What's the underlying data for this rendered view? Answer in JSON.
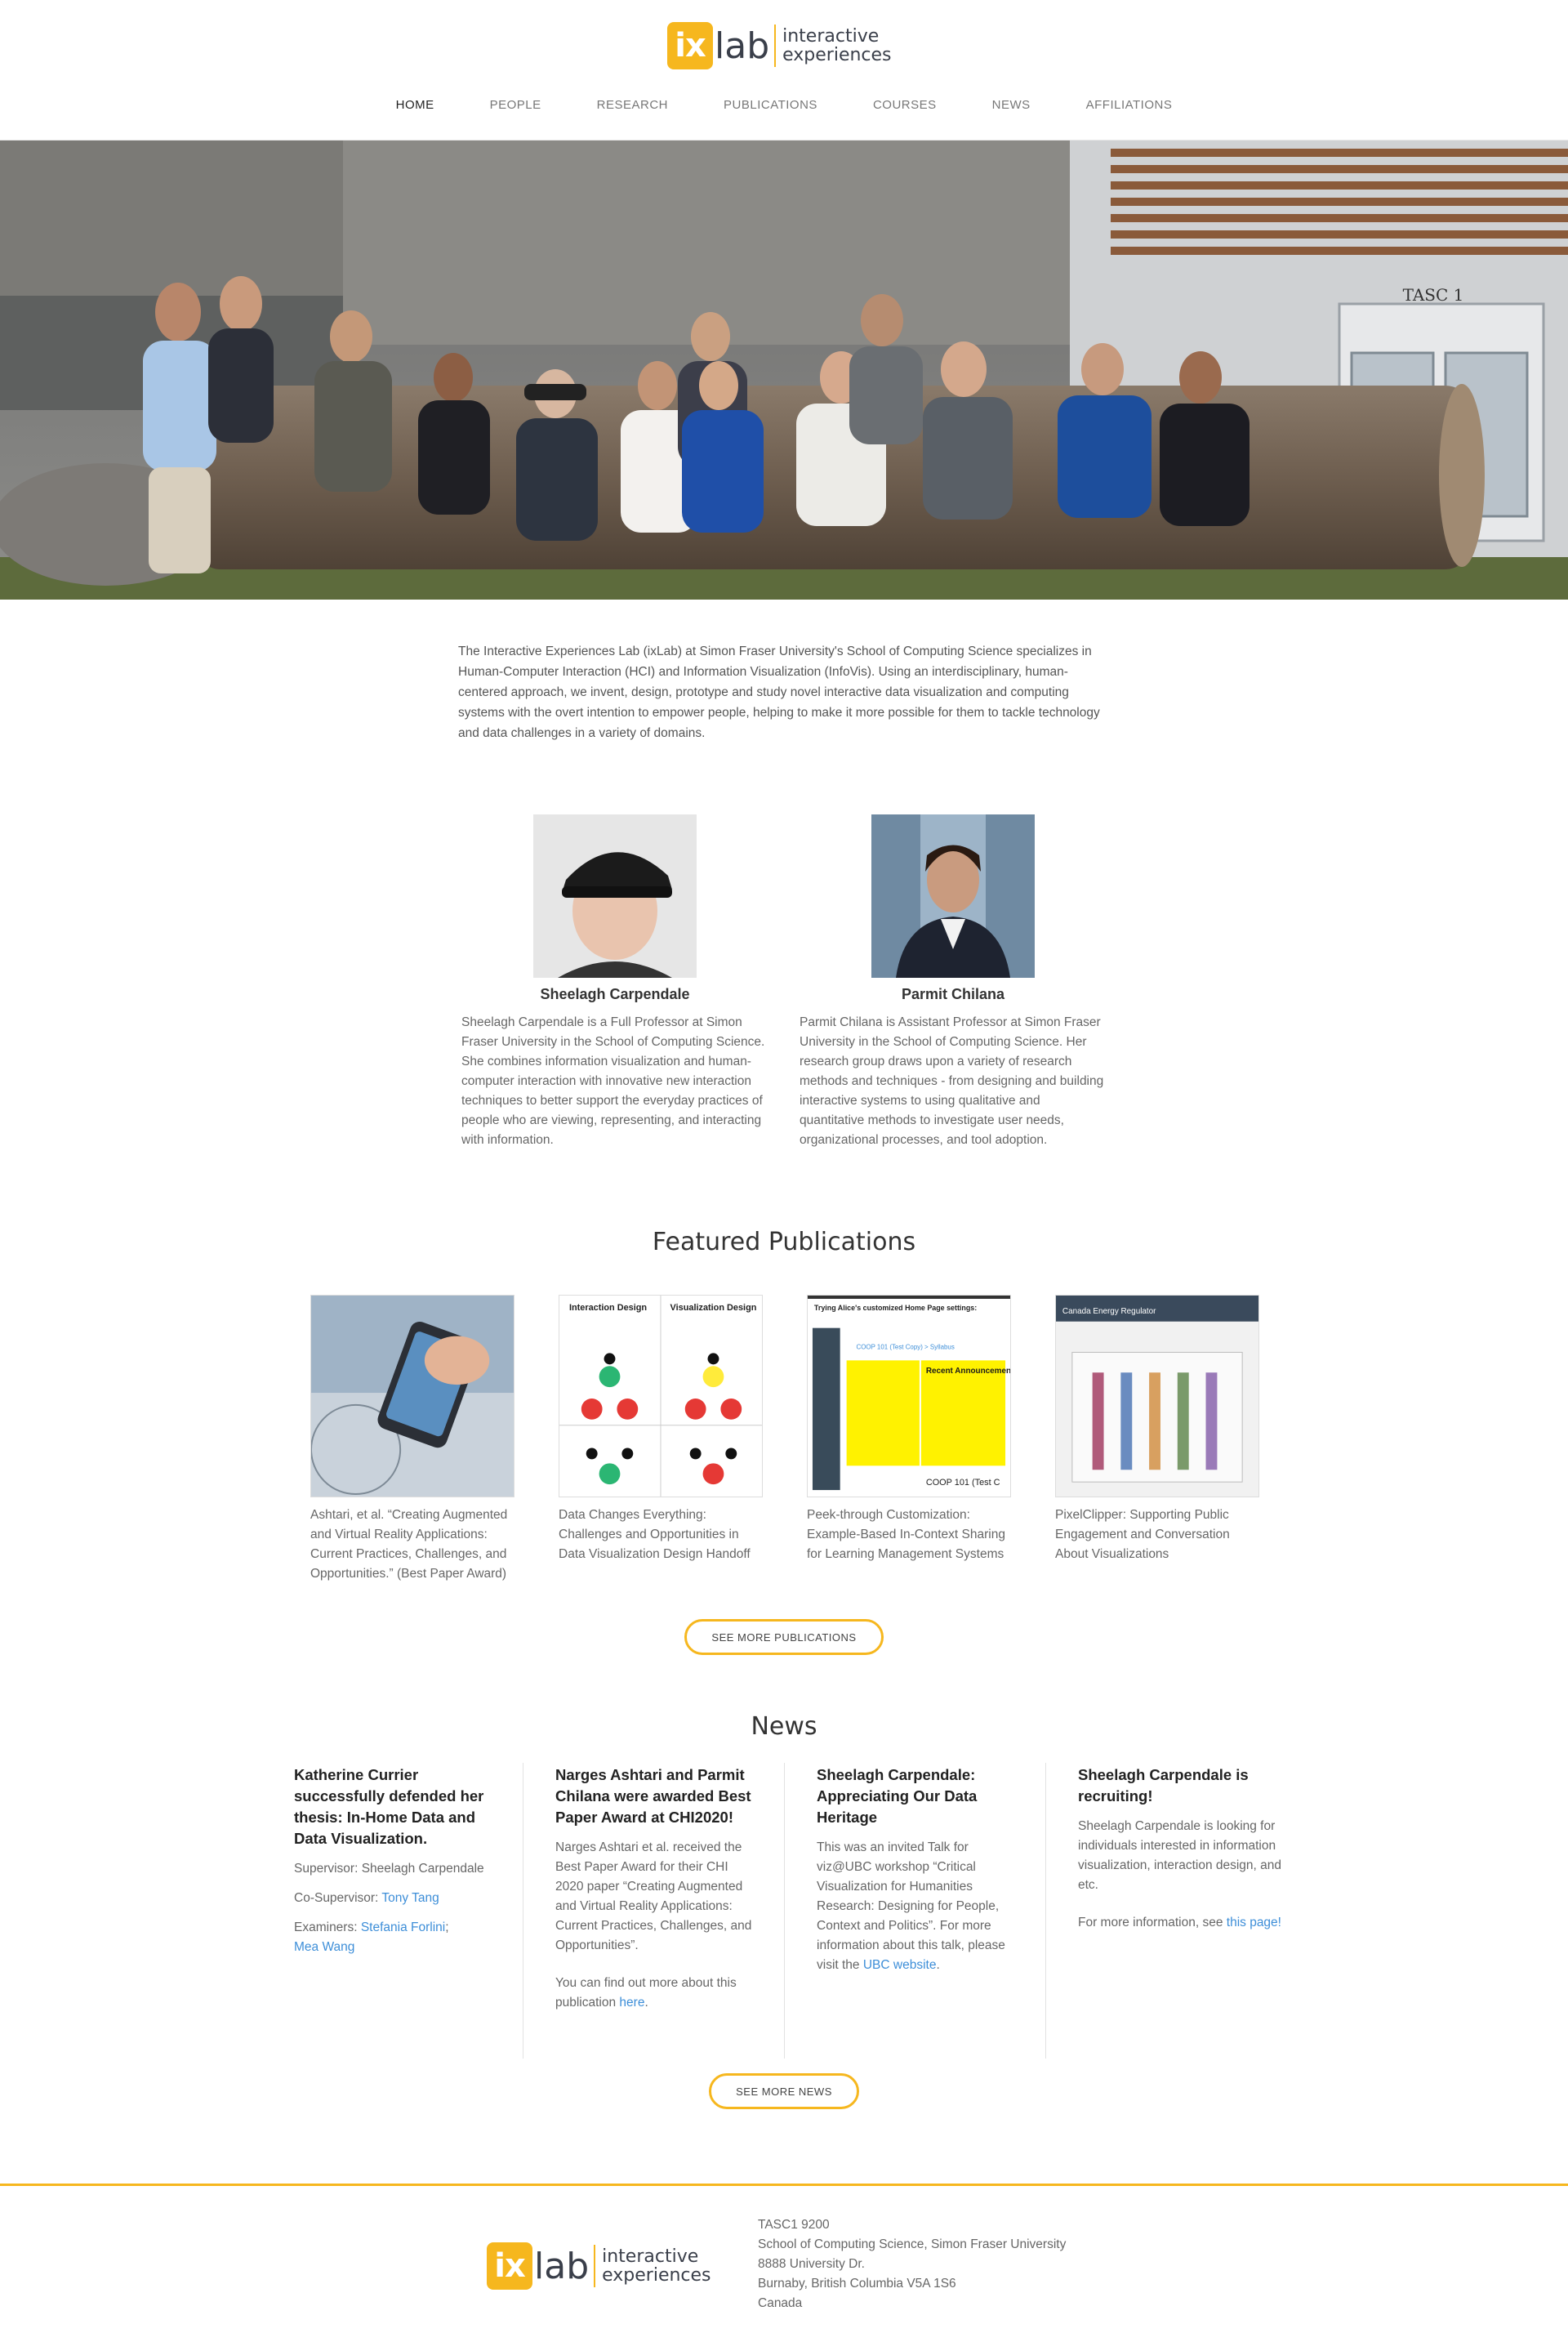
{
  "header": {
    "logo_mark": "ix",
    "logo_word": "lab",
    "logo_line1": "interactive",
    "logo_line2": "experiences"
  },
  "nav": {
    "items": [
      "HOME",
      "PEOPLE",
      "RESEARCH",
      "PUBLICATIONS",
      "COURSES",
      "NEWS",
      "AFFILIATIONS"
    ]
  },
  "hero": {
    "sign_text": "TASC 1"
  },
  "intro": "The Interactive Experiences Lab (ixLab) at Simon Fraser University's School of Computing Science specializes in Human-Computer Interaction (HCI) and Information Visualization (InfoVis). Using an interdisciplinary, human-centered approach, we invent, design, prototype and study novel interactive data visualization and computing systems with the overt intention to empower people, helping to make it more possible for them to tackle technology and data challenges in a variety of domains.",
  "people": [
    {
      "name": "Sheelagh Carpendale",
      "bio": "Sheelagh Carpendale is a Full Professor at Simon Fraser University in the School of Computing Science. She combines information visualization and human-computer interaction with innovative new interaction techniques to better support the everyday practices of people who are viewing, representing, and interacting with information."
    },
    {
      "name": "Parmit Chilana",
      "bio": "Parmit Chilana is Assistant Professor at Simon Fraser University in the School of Computing Science. Her research group draws upon a variety of research methods and techniques - from designing and building interactive systems to using qualitative and quantitative methods to investigate user needs, organizational processes, and tool adoption."
    }
  ],
  "publications": {
    "title": "Featured Publications",
    "items": [
      {
        "caption": "Ashtari, et al. “Creating Augmented and Virtual Reality Applications: Current Practices, Challenges, and Opportunities.” (Best Paper Award)"
      },
      {
        "caption": "Data Changes Everything: Challenges and Opportunities in Data Visualization Design Handoff",
        "thumb_left": "Interaction Design",
        "thumb_right": "Visualization Design"
      },
      {
        "caption": "Peek-through Customization: Example-Based In-Context Sharing for Learning Management Systems",
        "thumb_header": "Trying Alice's customized Home Page settings:",
        "thumb_crumb": "COOP 101 (Test Copy) > Syllabus",
        "thumb_box": "Recent Announcements",
        "thumb_footer": "COOP 101 (Test C"
      },
      {
        "caption": "PixelClipper: Supporting Public Engagement and Conversation About Visualizations",
        "thumb_header": "Canada Energy Regulator"
      }
    ],
    "button": "SEE MORE PUBLICATIONS"
  },
  "news": {
    "title": "News",
    "items": [
      {
        "title": "Katherine Currier successfully defended her thesis: In-Home Data and Data Visualization.",
        "p1": "Supervisor: Sheelagh Carpendale",
        "p2_prefix": "Co-Supervisor: ",
        "p2_link": "Tony Tang",
        "p3_prefix": "Examiners: ",
        "p3_link1": "Stefania Forlini",
        "p3_sep": ";",
        "p3_link2": "Mea Wang"
      },
      {
        "title": "Narges Ashtari and Parmit Chilana were awarded Best Paper Award at CHI2020!",
        "p1": "Narges Ashtari et al. received the Best Paper Award for their CHI 2020 paper “Creating Augmented and Virtual Reality Applications: Current Practices, Challenges, and Opportunities”.",
        "p2_prefix": "You can find out more about this publication ",
        "p2_link": "here",
        "p2_suffix": "."
      },
      {
        "title": "Sheelagh Carpendale: Appreciating Our Data Heritage",
        "p1_prefix": "This was an invited Talk for viz@UBC workshop “Critical Visualization for Humanities Research: Designing for People, Context and Politics”. For more information about this talk, please visit the ",
        "p1_link": "UBC website",
        "p1_suffix": "."
      },
      {
        "title": "Sheelagh Carpendale is recruiting!",
        "p1": "Sheelagh Carpendale is looking for individuals interested in information visualization, interaction design, and etc.",
        "p2_prefix": "For more information, see ",
        "p2_link": "this page!"
      }
    ],
    "button": "SEE MORE NEWS"
  },
  "footer": {
    "address": [
      "TASC1 9200",
      "School of Computing Science, Simon Fraser University",
      "8888 University Dr.",
      "Burnaby, British Columbia V5A 1S6",
      "Canada"
    ]
  },
  "colors": {
    "accent": "#f6b71e",
    "link": "#3d8ed8",
    "text_dark": "#333333",
    "text_body": "#666666"
  }
}
